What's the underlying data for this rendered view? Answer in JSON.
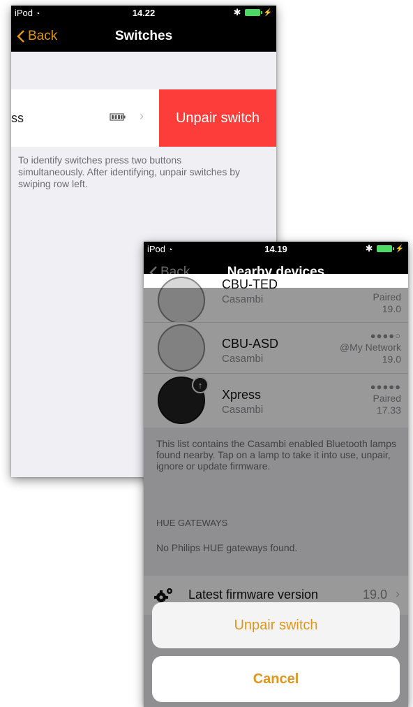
{
  "colors": {
    "accent": "#e0961e",
    "destructive": "#fc3d39",
    "battery": "#4cd964",
    "navbar": "#000000"
  },
  "screen1": {
    "status": {
      "carrier": "iPod",
      "time": "14.22"
    },
    "nav": {
      "back_label": "Back",
      "title": "Switches"
    },
    "switch_row": {
      "name": "ss",
      "icons": [
        "battery-icon",
        "chevron-right-icon"
      ]
    },
    "unpair_action": "Unpair switch",
    "footer_note": "To identify switches press two buttons simultaneously. After identifying, unpair switches by swiping row left."
  },
  "screen2": {
    "status": {
      "carrier": "iPod",
      "time": "14.19"
    },
    "nav": {
      "back_label": "Back",
      "title": "Nearby devices"
    },
    "devices": [
      {
        "name": "CBU-TED",
        "vendor": "Casambi",
        "status": "Paired",
        "version": "19.0"
      },
      {
        "name": "CBU-ASD",
        "vendor": "Casambi",
        "signal": "●●●●○",
        "status": "@My Network",
        "version": "19.0"
      },
      {
        "name": "Xpress",
        "vendor": "Casambi",
        "signal": "●●●●●",
        "status": "Paired",
        "version": "17.33"
      }
    ],
    "info_text": "This list contains the Casambi enabled Bluetooth lamps found nearby. Tap on a lamp to take it into use, unpair, ignore or update firmware.",
    "hue_header": "HUE GATEWAYS",
    "hue_note": "No Philips HUE gateways found.",
    "firmware": {
      "label": "Latest firmware version",
      "value": "19.0"
    },
    "action_sheet": {
      "primary": "Unpair switch",
      "cancel": "Cancel"
    }
  }
}
